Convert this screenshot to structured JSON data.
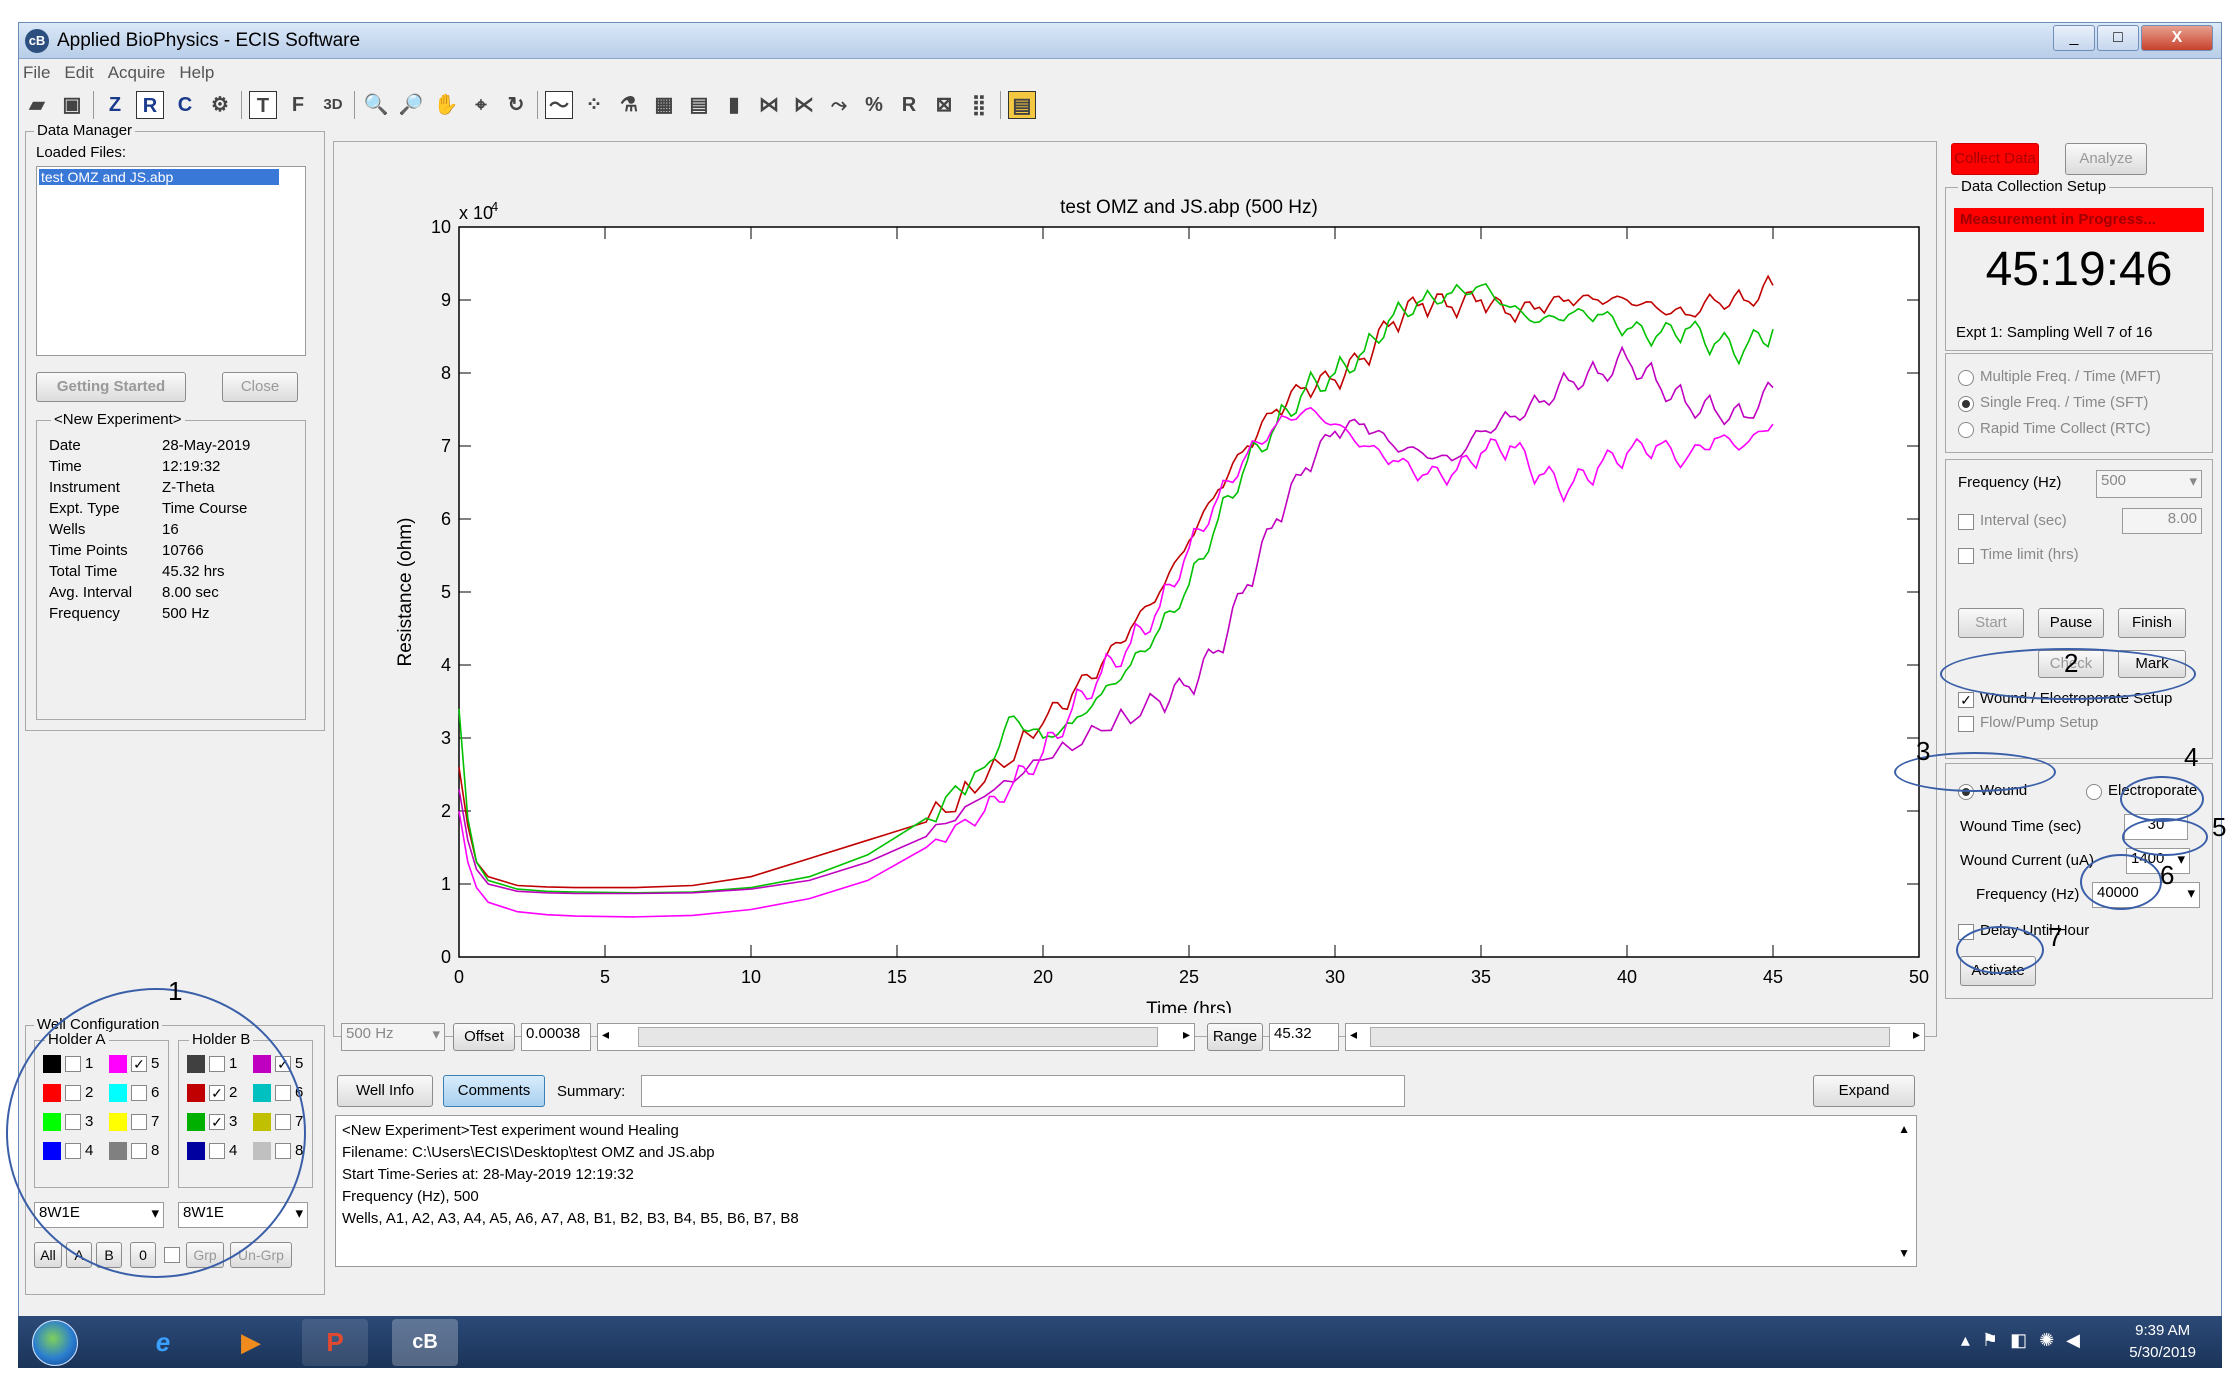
{
  "window": {
    "title": "Applied BioPhysics - ECIS Software",
    "controls": [
      "_",
      "□",
      "X"
    ]
  },
  "menu": [
    "File",
    "Edit",
    "Acquire",
    "Help"
  ],
  "toolbar": {
    "z": "Z",
    "r": "R",
    "c": "C",
    "t": "T",
    "f": "F",
    "three_d": "3D"
  },
  "data_manager": {
    "title": "Data Manager",
    "loaded_files_label": "Loaded Files:",
    "files": [
      "test OMZ and JS.abp"
    ],
    "getting_started": "Getting Started",
    "close": "Close",
    "experiment_title": "<New Experiment>",
    "experiment": [
      [
        "Date",
        "28-May-2019"
      ],
      [
        "Time",
        "12:19:32"
      ],
      [
        "Instrument",
        "Z-Theta"
      ],
      [
        "Expt. Type",
        "Time Course"
      ],
      [
        "Wells",
        "16"
      ],
      [
        "Time Points",
        "10766"
      ],
      [
        "Total Time",
        "45.32 hrs"
      ],
      [
        "Avg. Interval",
        "8.00 sec"
      ],
      [
        "Frequency",
        "500 Hz"
      ]
    ]
  },
  "well_config": {
    "title": "Well Configuration",
    "holder_a": "Holder A",
    "holder_b": "Holder B",
    "a_left": [
      {
        "n": "1",
        "color": "#000000",
        "checked": false
      },
      {
        "n": "2",
        "color": "#ff0000",
        "checked": false
      },
      {
        "n": "3",
        "color": "#00ff00",
        "checked": false
      },
      {
        "n": "4",
        "color": "#0000ff",
        "checked": false
      }
    ],
    "a_right": [
      {
        "n": "5",
        "color": "#ff00ff",
        "checked": true
      },
      {
        "n": "6",
        "color": "#00ffff",
        "checked": false
      },
      {
        "n": "7",
        "color": "#ffff00",
        "checked": false
      },
      {
        "n": "8",
        "color": "#808080",
        "checked": false
      }
    ],
    "b_left": [
      {
        "n": "1",
        "color": "#404040",
        "checked": false
      },
      {
        "n": "2",
        "color": "#c00000",
        "checked": true
      },
      {
        "n": "3",
        "color": "#00b000",
        "checked": true
      },
      {
        "n": "4",
        "color": "#0000a0",
        "checked": false
      }
    ],
    "b_right": [
      {
        "n": "5",
        "color": "#c000c0",
        "checked": true
      },
      {
        "n": "6",
        "color": "#00c0c0",
        "checked": false
      },
      {
        "n": "7",
        "color": "#c0c000",
        "checked": false
      },
      {
        "n": "8",
        "color": "#c0c0c0",
        "checked": false
      }
    ],
    "array_a": "8W1E",
    "array_b": "8W1E",
    "buttons": [
      "All",
      "A",
      "B",
      "0",
      "Grp",
      "Un-Grp"
    ]
  },
  "plot_controls": {
    "freq": "500 Hz",
    "offset_label": "Offset",
    "offset_value": "0.00038",
    "range_label": "Range",
    "range_value": "45.32"
  },
  "comments": {
    "well_info": "Well Info",
    "comments": "Comments",
    "summary_label": "Summary:",
    "expand": "Expand",
    "lines": [
      "<New Experiment>Test experiment wound Healing",
      "Filename: C:\\Users\\ECIS\\Desktop\\test OMZ and JS.abp",
      "Start Time-Series at: 28-May-2019 12:19:32",
      "Frequency (Hz), 500",
      "Wells, A1, A2, A3, A4, A5, A6, A7, A8, B1, B2, B3, B4, B5, B6, B7, B8"
    ]
  },
  "right": {
    "collect_data": "Collect Data",
    "analyze": "Analyze",
    "setup_title": "Data Collection Setup",
    "status": "Measurement in Progress...",
    "timer": "45:19:46",
    "expt_line": "Expt 1: Sampling Well 7 of 16",
    "modes": [
      "Multiple Freq. / Time (MFT)",
      "Single Freq. / Time (SFT)",
      "Rapid Time Collect (RTC)"
    ],
    "frequency_label": "Frequency (Hz)",
    "frequency_value": "500",
    "interval_label": "Interval (sec)",
    "interval_value": "8.00",
    "time_limit_label": "Time limit (hrs)",
    "start": "Start",
    "pause": "Pause",
    "finish": "Finish",
    "check": "Check",
    "mark": "Mark",
    "wound_setup": "Wound / Electroporate Setup",
    "flow_setup": "Flow/Pump Setup",
    "wound": "Wound",
    "electroporate": "Electroporate",
    "wound_time_label": "Wound Time (sec)",
    "wound_time": "30",
    "wound_current_label": "Wound Current (uA)",
    "wound_current": "1400",
    "freq2_label": "Frequency (Hz)",
    "freq2": "40000",
    "delay_label": "Delay Until Hour",
    "activate": "Activate"
  },
  "annotations": [
    "1",
    "2",
    "3",
    "4",
    "5",
    "6",
    "7"
  ],
  "taskbar": {
    "time": "9:39 AM",
    "date": "5/30/2019"
  },
  "chart_data": {
    "type": "line",
    "title": "test OMZ and JS.abp (500 Hz)",
    "xlabel": "Time (hrs)",
    "ylabel": "Resistance (ohm)",
    "y_multiplier": "x 10",
    "y_multiplier_exp": "4",
    "xlim": [
      0,
      50
    ],
    "ylim": [
      0,
      10
    ],
    "xticks": [
      "0",
      "5",
      "10",
      "15",
      "20",
      "25",
      "30",
      "35",
      "40",
      "45",
      "50"
    ],
    "yticks": [
      "0",
      "1",
      "2",
      "3",
      "4",
      "5",
      "6",
      "7",
      "8",
      "9",
      "10"
    ],
    "series": [
      {
        "color": "#c00000",
        "x": [
          0,
          0.3,
          0.6,
          1,
          2,
          3,
          4,
          6,
          8,
          10,
          12,
          14,
          16,
          18,
          20,
          21,
          22,
          23,
          24,
          25,
          26,
          27,
          28,
          29,
          30,
          31,
          32,
          33,
          34,
          35,
          36,
          37,
          38,
          39,
          40,
          41,
          42,
          43,
          44,
          45
        ],
        "y": [
          2.6,
          1.8,
          1.3,
          1.1,
          0.98,
          0.96,
          0.95,
          0.95,
          0.98,
          1.1,
          1.35,
          1.6,
          1.85,
          2.4,
          3.2,
          3.6,
          4.0,
          4.5,
          5.0,
          5.7,
          6.4,
          7.0,
          7.5,
          7.8,
          7.9,
          8.2,
          8.7,
          8.95,
          8.9,
          9.0,
          8.8,
          8.9,
          9.0,
          9.0,
          9.0,
          8.9,
          8.8,
          9.0,
          9.0,
          9.2
        ]
      },
      {
        "color": "#00c000",
        "x": [
          0,
          0.3,
          0.6,
          1,
          2,
          3,
          4,
          6,
          8,
          10,
          12,
          14,
          16,
          18,
          19,
          20,
          21,
          22,
          23,
          24,
          25,
          26,
          27,
          28,
          29,
          30,
          31,
          32,
          33,
          34,
          35,
          36,
          37,
          38,
          39,
          40,
          41,
          42,
          43,
          44,
          45
        ],
        "y": [
          3.4,
          1.9,
          1.3,
          1.05,
          0.93,
          0.9,
          0.89,
          0.88,
          0.89,
          0.95,
          1.1,
          1.4,
          1.9,
          2.6,
          3.3,
          3.0,
          3.2,
          3.6,
          4.0,
          4.5,
          5.1,
          6.0,
          6.8,
          7.3,
          7.8,
          8.0,
          8.3,
          8.8,
          9.0,
          9.1,
          9.2,
          8.9,
          8.7,
          8.8,
          8.8,
          8.6,
          8.5,
          8.6,
          8.4,
          8.3,
          8.6
        ]
      },
      {
        "color": "#c000c0",
        "x": [
          0,
          0.3,
          0.6,
          1,
          2,
          3,
          4,
          6,
          8,
          10,
          12,
          14,
          16,
          18,
          20,
          22,
          24,
          25,
          26,
          27,
          28,
          29,
          30,
          31,
          32,
          33,
          34,
          35,
          36,
          37,
          38,
          39,
          40,
          41,
          42,
          43,
          44,
          45
        ],
        "y": [
          2.3,
          1.6,
          1.2,
          1.0,
          0.9,
          0.88,
          0.87,
          0.87,
          0.88,
          0.93,
          1.05,
          1.3,
          1.65,
          2.2,
          2.7,
          3.1,
          3.5,
          3.7,
          4.2,
          5.1,
          6.0,
          6.7,
          7.2,
          7.3,
          7.0,
          6.9,
          6.8,
          7.2,
          7.4,
          7.6,
          7.9,
          8.0,
          8.2,
          7.9,
          7.6,
          7.5,
          7.4,
          7.8
        ]
      },
      {
        "color": "#ff00ff",
        "x": [
          0,
          0.3,
          0.6,
          1,
          2,
          3,
          4,
          6,
          8,
          10,
          12,
          14,
          16,
          18,
          19,
          20,
          21,
          22,
          23,
          24,
          25,
          26,
          27,
          28,
          29,
          30,
          31,
          32,
          33,
          34,
          35,
          36,
          37,
          38,
          39,
          40,
          41,
          42,
          43,
          44,
          45
        ],
        "y": [
          2.0,
          1.3,
          0.95,
          0.75,
          0.62,
          0.58,
          0.56,
          0.55,
          0.57,
          0.65,
          0.8,
          1.05,
          1.5,
          2.0,
          2.4,
          2.8,
          3.4,
          3.9,
          4.3,
          4.8,
          5.6,
          6.3,
          6.9,
          7.3,
          7.5,
          7.3,
          7.0,
          6.8,
          6.6,
          6.6,
          6.9,
          7.0,
          6.6,
          6.4,
          6.7,
          6.9,
          7.0,
          6.8,
          7.1,
          7.0,
          7.3
        ]
      }
    ]
  }
}
